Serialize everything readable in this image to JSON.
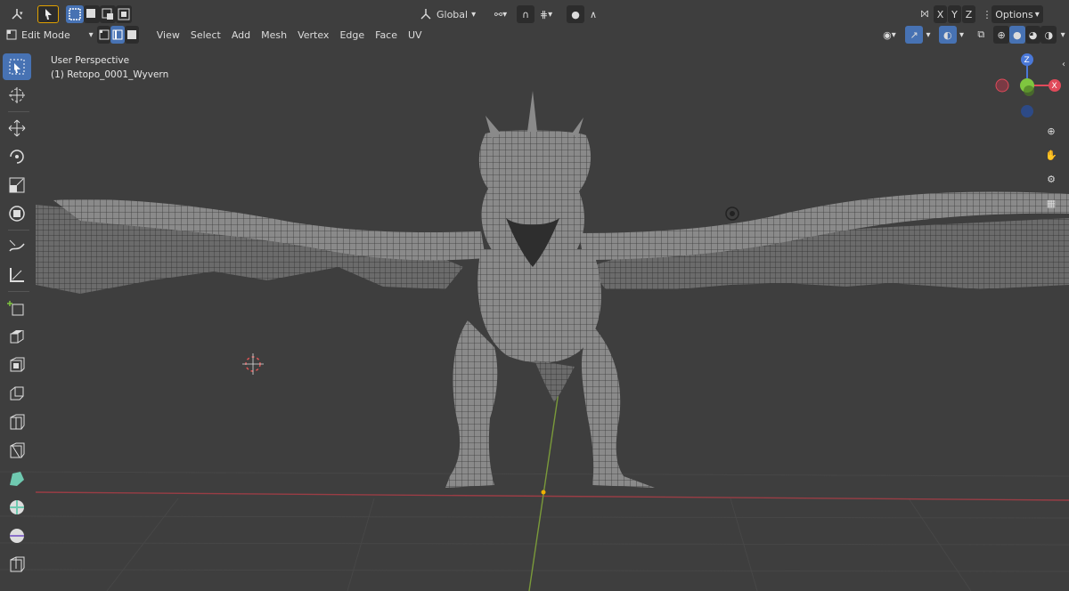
{
  "header": {
    "transform_orientation": "Global",
    "options_label": "Options",
    "axis_x": "X",
    "axis_y": "Y",
    "axis_z": "Z"
  },
  "menubar": {
    "mode": "Edit Mode",
    "items": [
      "View",
      "Select",
      "Add",
      "Mesh",
      "Vertex",
      "Edge",
      "Face",
      "UV"
    ]
  },
  "viewport": {
    "view_name": "User Perspective",
    "object_name": "(1) Retopo_0001_Wyvern"
  },
  "gizmo": {
    "x_color": "#e04a5a",
    "y_color": "#7fc63f",
    "z_color": "#4a78d8"
  },
  "icons": {
    "toolbar": [
      "select-box-icon",
      "cursor-icon",
      "move-icon",
      "rotate-icon",
      "scale-icon",
      "transform-icon",
      "annotate-icon",
      "measure-icon",
      "add-cube-icon",
      "extrude-icon",
      "inset-icon",
      "bevel-icon",
      "loop-cut-icon",
      "knife-icon",
      "poly-build-icon",
      "spin-icon",
      "smooth-icon",
      "edge-slide-icon"
    ]
  }
}
